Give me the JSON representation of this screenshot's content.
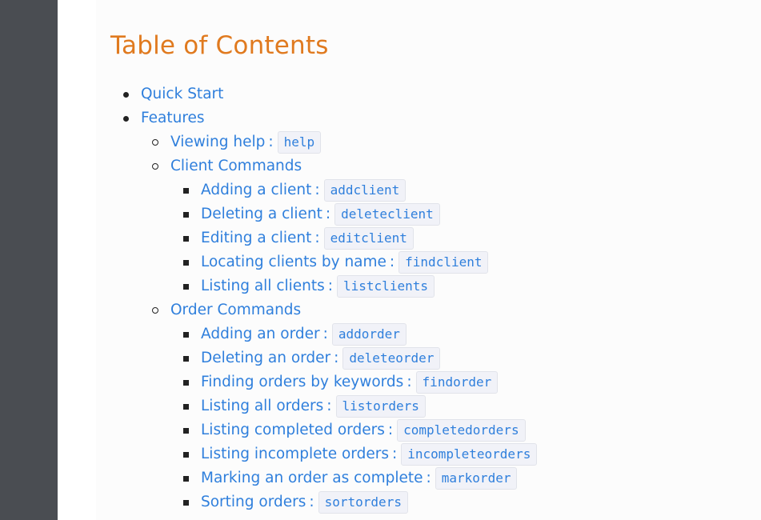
{
  "toc": {
    "title": "Table of Contents",
    "separator": ":",
    "items": [
      {
        "label": "Quick Start"
      },
      {
        "label": "Features"
      },
      {
        "label": "Viewing help",
        "command": "help"
      },
      {
        "label": "Client Commands"
      },
      {
        "label": "Adding a client",
        "command": "addclient"
      },
      {
        "label": "Deleting a client",
        "command": "deleteclient"
      },
      {
        "label": "Editing a client",
        "command": "editclient"
      },
      {
        "label": "Locating clients by name",
        "command": "findclient"
      },
      {
        "label": "Listing all clients",
        "command": "listclients"
      },
      {
        "label": "Order Commands"
      },
      {
        "label": "Adding an order",
        "command": "addorder"
      },
      {
        "label": "Deleting an order",
        "command": "deleteorder"
      },
      {
        "label": "Finding orders by keywords",
        "command": "findorder"
      },
      {
        "label": "Listing all orders",
        "command": "listorders"
      },
      {
        "label": "Listing completed orders",
        "command": "completedorders"
      },
      {
        "label": "Listing incomplete orders",
        "command": "incompleteorders"
      },
      {
        "label": "Marking an order as complete",
        "command": "markorder"
      },
      {
        "label": "Sorting orders",
        "command": "sortorders"
      }
    ]
  }
}
